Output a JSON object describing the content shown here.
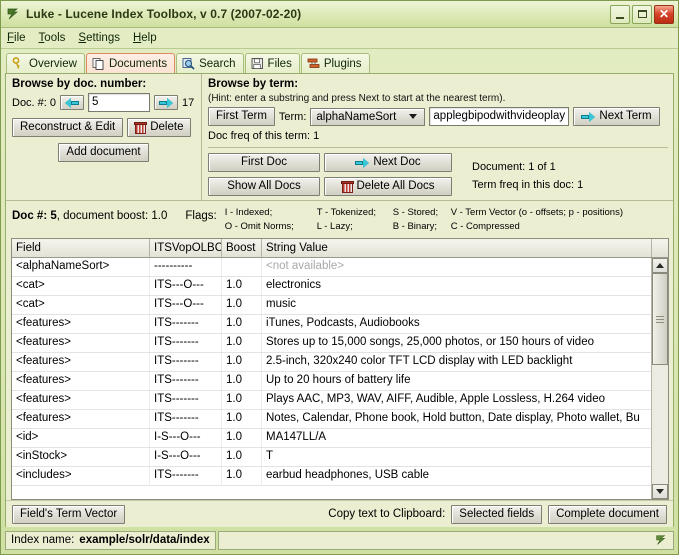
{
  "window": {
    "title": "Luke - Lucene Index Toolbox, v 0.7 (2007-02-20)",
    "icon": "luke-icon",
    "minimize_label": "Minimize",
    "maximize_label": "Maximize",
    "close_label": "✕"
  },
  "menu": {
    "items": [
      {
        "label": "File",
        "mnemonic": "F",
        "rest": "ile"
      },
      {
        "label": "Tools",
        "mnemonic": "T",
        "rest": "ools"
      },
      {
        "label": "Settings",
        "mnemonic": "S",
        "rest": "ettings"
      },
      {
        "label": "Help",
        "mnemonic": "H",
        "rest": "elp"
      }
    ]
  },
  "tabs": [
    {
      "label": "Overview",
      "icon": "key-icon",
      "active": false
    },
    {
      "label": "Documents",
      "icon": "documents-icon",
      "active": true
    },
    {
      "label": "Search",
      "icon": "magnifier-icon",
      "active": false
    },
    {
      "label": "Files",
      "icon": "floppy-icon",
      "active": false
    },
    {
      "label": "Plugins",
      "icon": "plugins-icon",
      "active": false
    }
  ],
  "browse_by_doc": {
    "title": "Browse by doc. number:",
    "doc_num_label": "Doc. #: 0",
    "prev_icon": "left-arrow-icon",
    "next_icon": "right-arrow-icon",
    "doc_value": "5",
    "max_doc": "17",
    "reconstruct_label": "Reconstruct & Edit",
    "delete_label": "Delete",
    "delete_icon": "trash-icon",
    "add_document_label": "Add document"
  },
  "browse_by_term": {
    "title": "Browse by term:",
    "hint": "(Hint: enter a substring and press Next to start at the nearest term).",
    "first_term_label": "First Term",
    "term_label": "Term:",
    "field_selected": "alphaNameSort",
    "term_value": "applegbipodwithvideoplay",
    "next_term_label": "Next Term",
    "next_term_icon": "right-arrow-icon",
    "doc_freq_label": "Doc freq of this term: 1",
    "first_doc_label": "First Doc",
    "next_doc_label": "Next Doc",
    "next_doc_icon": "right-arrow-icon",
    "show_all_docs_label": "Show All Docs",
    "delete_all_docs_label": "Delete All Docs",
    "delete_all_docs_icon": "trash-icon",
    "document_counter": "Document: 1  of 1",
    "term_freq_label": "Term freq in this doc: 1"
  },
  "doc_info": {
    "doc_num_label": "Doc #: 5",
    "boost_label": ", document boost: 1.0",
    "flags_label": "Flags:",
    "legend": [
      [
        "I - Indexed;",
        "T - Tokenized;",
        "S - Stored;",
        "V - Term Vector (o - offsets; p - positions)"
      ],
      [
        "O - Omit Norms;",
        "L - Lazy;",
        "B - Binary;",
        "C - Compressed"
      ]
    ]
  },
  "table": {
    "columns": [
      "Field",
      "ITSVopOLBC",
      "Boost",
      "String Value"
    ],
    "rows": [
      {
        "field": "<alphaNameSort>",
        "flags": "----------",
        "boost": "",
        "value": "<not available>",
        "unavailable": true
      },
      {
        "field": "<cat>",
        "flags": "ITS---O---",
        "boost": "1.0",
        "value": "electronics"
      },
      {
        "field": "<cat>",
        "flags": "ITS---O---",
        "boost": "1.0",
        "value": "music"
      },
      {
        "field": "<features>",
        "flags": "ITS-------",
        "boost": "1.0",
        "value": "iTunes, Podcasts, Audiobooks"
      },
      {
        "field": "<features>",
        "flags": "ITS-------",
        "boost": "1.0",
        "value": "Stores up to 15,000 songs, 25,000 photos, or 150 hours of video"
      },
      {
        "field": "<features>",
        "flags": "ITS-------",
        "boost": "1.0",
        "value": "2.5-inch, 320x240 color TFT LCD display with LED backlight"
      },
      {
        "field": "<features>",
        "flags": "ITS-------",
        "boost": "1.0",
        "value": "Up to 20 hours of battery life"
      },
      {
        "field": "<features>",
        "flags": "ITS-------",
        "boost": "1.0",
        "value": "Plays AAC, MP3, WAV, AIFF, Audible, Apple Lossless, H.264 video"
      },
      {
        "field": "<features>",
        "flags": "ITS-------",
        "boost": "1.0",
        "value": "Notes, Calendar, Phone book, Hold button, Date display, Photo wallet, Bu"
      },
      {
        "field": "<id>",
        "flags": "I-S---O---",
        "boost": "1.0",
        "value": "MA147LL/A"
      },
      {
        "field": "<inStock>",
        "flags": "I-S---O---",
        "boost": "1.0",
        "value": "T"
      },
      {
        "field": "<includes>",
        "flags": "ITS-------",
        "boost": "1.0",
        "value": "earbud headphones, USB cable"
      }
    ],
    "scroll_up_icon": "scroll-up-icon",
    "scroll_down_icon": "scroll-down-icon"
  },
  "action_bar": {
    "term_vector_label": "Field's Term Vector",
    "clipboard_label": "Copy text to Clipboard:",
    "selected_fields_label": "Selected fields",
    "complete_document_label": "Complete document"
  },
  "status_bar": {
    "index_name_label": "Index name:",
    "index_name_value": "example/solr/data/index",
    "icon": "luke-icon"
  },
  "colors": {
    "window_chrome": "#d7e6ae",
    "panel_bg": "#eceed2",
    "active_tab": "#fbe3d3",
    "active_tab_border": "#e08a63",
    "arrow_accent": "#39c7d8",
    "title_text": "#2b3a14",
    "close_button": "#c8381d"
  }
}
